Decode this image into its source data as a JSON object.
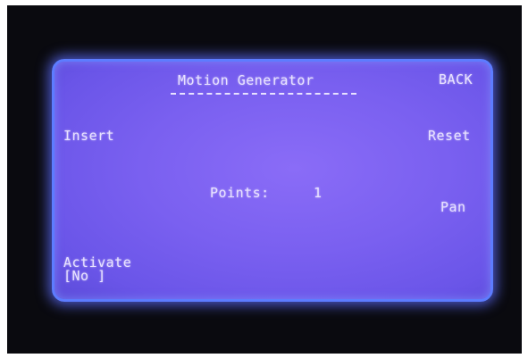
{
  "screen": {
    "title": "Motion Generator",
    "back_label": "BACK",
    "insert_label": "Insert",
    "reset_label": "Reset",
    "points_label": "Points:",
    "points_value": "1",
    "pan_label": "Pan",
    "activate_label": "Activate",
    "activate_value": "[No ]"
  }
}
